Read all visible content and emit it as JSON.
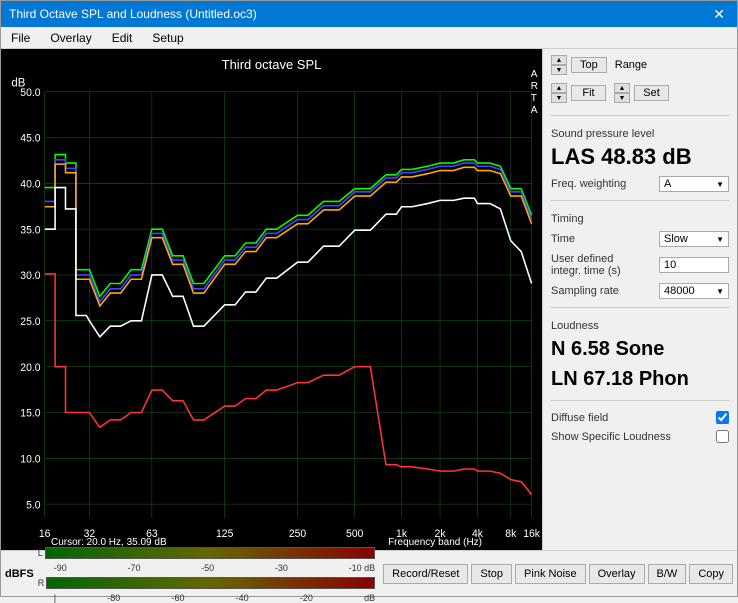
{
  "window": {
    "title": "Third Octave SPL and Loudness (Untitled.oc3)",
    "close_label": "✕"
  },
  "menu": {
    "items": [
      "File",
      "Overlay",
      "Edit",
      "Setup"
    ]
  },
  "chart": {
    "title": "Third octave SPL",
    "arta_label": "A\nR\nT\nA",
    "y_axis": {
      "label": "dB",
      "values": [
        "50.0",
        "45.0",
        "40.0",
        "35.0",
        "30.0",
        "25.0",
        "20.0",
        "15.0",
        "10.0",
        "5.0"
      ]
    },
    "x_axis": {
      "values": [
        "16",
        "32",
        "63",
        "125",
        "250",
        "500",
        "1k",
        "2k",
        "4k",
        "8k",
        "16k"
      ]
    },
    "cursor_info": "Cursor:  20.0 Hz, 35.09 dB",
    "freq_band_label": "Frequency band (Hz)"
  },
  "right_panel": {
    "top_btn": "Top",
    "fit_btn": "Fit",
    "range_label": "Range",
    "set_btn": "Set",
    "spl_section": "Sound pressure level",
    "spl_value": "LAS 48.83 dB",
    "freq_weighting_label": "Freq. weighting",
    "freq_weighting_value": "A",
    "timing_section": "Timing",
    "time_label": "Time",
    "time_value": "Slow",
    "user_defined_label": "User defined\nintegr. time (s)",
    "user_defined_value": "10",
    "sampling_rate_label": "Sampling rate",
    "sampling_rate_value": "48000",
    "loudness_section": "Loudness",
    "loudness_n": "N 6.58 Sone",
    "loudness_ln": "LN 67.18 Phon",
    "diffuse_field_label": "Diffuse field",
    "diffuse_field_checked": true,
    "show_specific_label": "Show Specific Loudness",
    "show_specific_checked": false
  },
  "bottom": {
    "dbfs_label": "dBFS",
    "meter_labels_top": [
      "-90",
      "-70",
      "-50",
      "-30",
      "-10 dB"
    ],
    "meter_labels_bottom": [
      "-80",
      "-60",
      "-40",
      "-20",
      "dB"
    ],
    "buttons": [
      "Record/Reset",
      "Stop",
      "Pink Noise",
      "Overlay",
      "B/W",
      "Copy"
    ]
  }
}
